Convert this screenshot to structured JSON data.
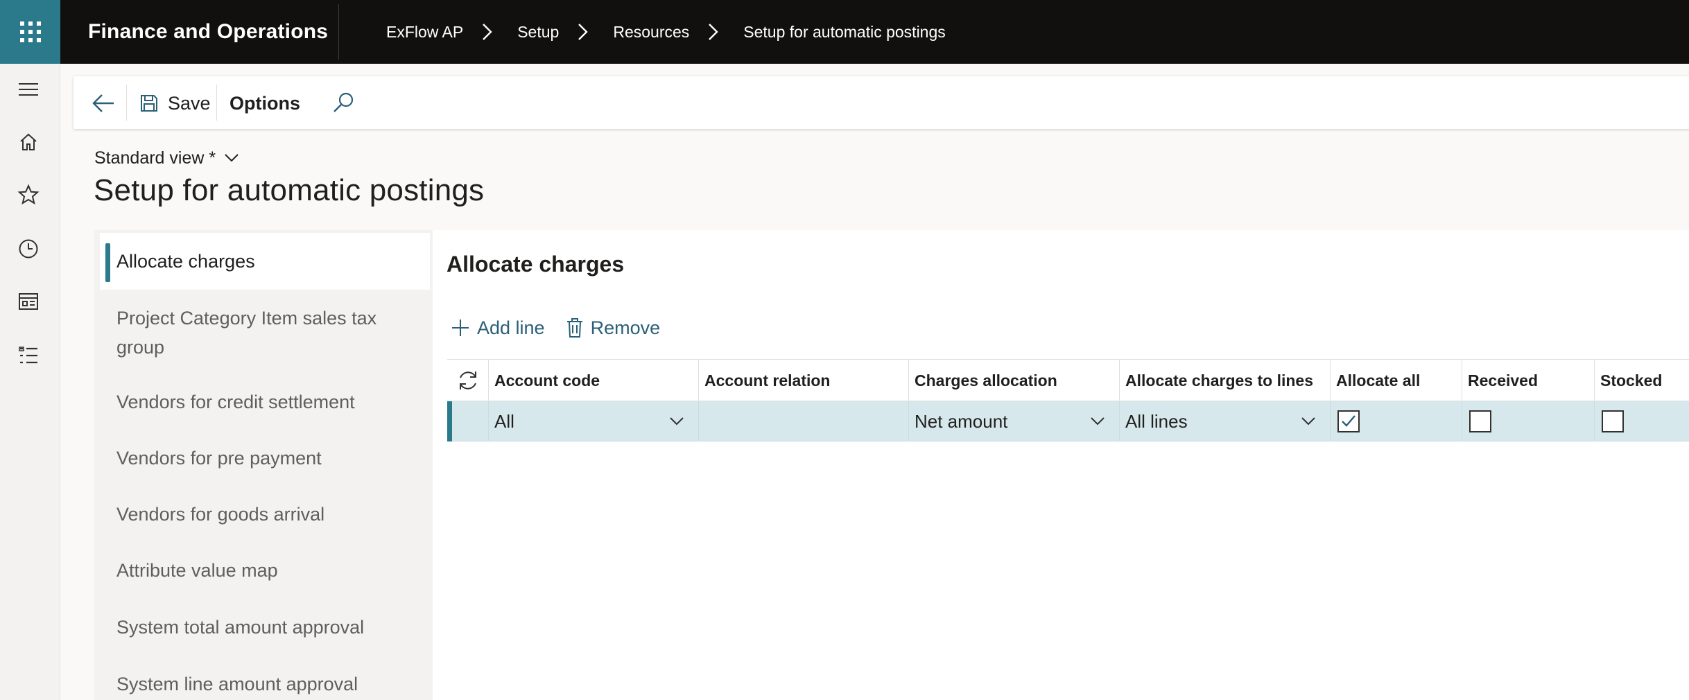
{
  "app": {
    "title": "Finance and Operations"
  },
  "breadcrumb": [
    "ExFlow AP",
    "Setup",
    "Resources",
    "Setup for automatic postings"
  ],
  "rail": {
    "icons": [
      "menu-icon",
      "home-icon",
      "star-icon",
      "clock-icon",
      "workspace-icon",
      "list-icon"
    ]
  },
  "actionpane": {
    "save_label": "Save",
    "options_label": "Options"
  },
  "view": {
    "label": "Standard view *"
  },
  "page": {
    "title": "Setup for automatic postings"
  },
  "tabs": [
    {
      "label": "Allocate charges",
      "active": true
    },
    {
      "label": "Project Category Item sales tax group"
    },
    {
      "label": "Vendors for credit settlement"
    },
    {
      "label": "Vendors for pre payment"
    },
    {
      "label": "Vendors for goods arrival"
    },
    {
      "label": "Attribute value map"
    },
    {
      "label": "System total amount approval"
    },
    {
      "label": "System line amount approval"
    }
  ],
  "section": {
    "title": "Allocate charges",
    "add_line_label": "Add line",
    "remove_label": "Remove"
  },
  "grid": {
    "columns": [
      "Account code",
      "Account relation",
      "Charges allocation",
      "Allocate charges to lines",
      "Allocate all",
      "Received",
      "Stocked"
    ],
    "rows": [
      {
        "account_code": "All",
        "account_relation": "",
        "charges_allocation": "Net amount",
        "allocate_charges_to_lines": "All lines",
        "allocate_all": true,
        "received": false,
        "stocked": false
      }
    ]
  },
  "colors": {
    "accent": "#2a7a8c",
    "topbar": "#11100f",
    "selected_row": "#d6e8ec",
    "link": "#2a5f78"
  }
}
